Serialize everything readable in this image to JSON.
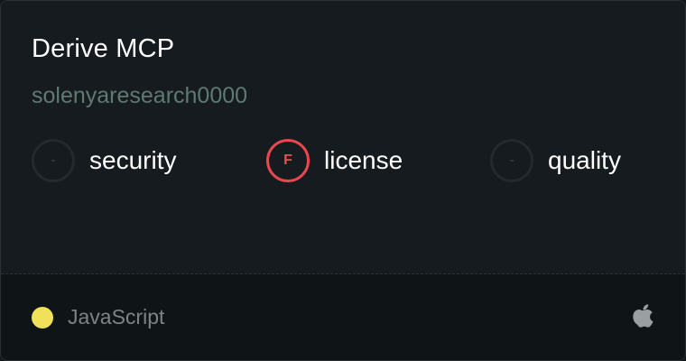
{
  "server": {
    "name": "Derive MCP",
    "owner": "solenyaresearch0000"
  },
  "scores": [
    {
      "key": "security",
      "label": "security",
      "grade": "-"
    },
    {
      "key": "license",
      "label": "license",
      "grade": "F"
    },
    {
      "key": "quality",
      "label": "quality",
      "grade": "-"
    }
  ],
  "footer": {
    "language": "JavaScript",
    "language_color": "#f1e05a",
    "platform_icon": "apple-icon"
  },
  "colors": {
    "fail_grade": "#e8474f",
    "owner_text": "#5f7a72"
  }
}
